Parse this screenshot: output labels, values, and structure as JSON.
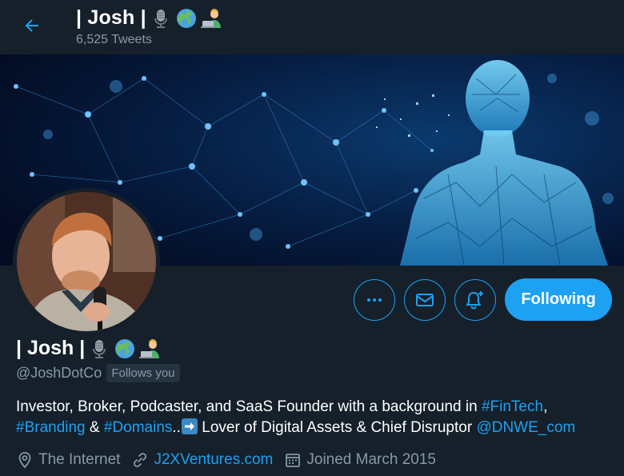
{
  "header": {
    "back_icon": "arrow-left-icon",
    "name": "| Josh |",
    "tweets_count": "6,525 Tweets"
  },
  "emojis": [
    "microphone-icon",
    "globe-icon",
    "technologist-icon"
  ],
  "banner": {
    "description_icon": "digital-human-network-banner"
  },
  "actions": {
    "more_icon": "more-dots-icon",
    "message_icon": "mail-icon",
    "notify_icon": "bell-plus-icon",
    "follow_label": "Following"
  },
  "profile": {
    "name": "| Josh |",
    "handle": "@JoshDotCo",
    "follows_you": "Follows you",
    "bio": {
      "line1_text": "Investor, Broker, Podcaster, and SaaS Founder with a background in ",
      "hashtag_fintech": "#FinTech",
      "comma": ",",
      "hashtag_branding": "#Branding",
      "amp": " & ",
      "hashtag_domains": "#Domains",
      "dots": "..",
      "arrow_icon": "right-arrow-emoji",
      "line2_text": " Lover of Digital Assets & Chief Disruptor ",
      "mention": "@DNWE_com"
    },
    "location": "The Internet",
    "website": "J2XVentures.com",
    "joined": "Joined March 2015"
  },
  "colors": {
    "background": "#15202b",
    "accent": "#1da1f2",
    "secondary_text": "#8899a6"
  }
}
